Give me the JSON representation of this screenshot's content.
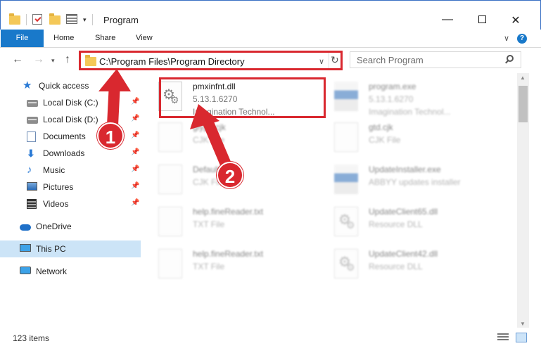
{
  "window": {
    "title": "Program",
    "min_glyph": "—",
    "close_glyph": "✕"
  },
  "ribbon": {
    "tabs": [
      "File",
      "Home",
      "Share",
      "View"
    ],
    "expand_glyph": "∨",
    "help_glyph": "?"
  },
  "nav": {
    "back_glyph": "←",
    "forward_glyph": "→",
    "recent_glyph": "▾",
    "up_glyph": "↑",
    "address": "C:\\Program Files\\Program Directory",
    "address_dropdown_glyph": "∨",
    "refresh_glyph": "↻",
    "search_placeholder": "Search Program"
  },
  "sidebar": {
    "items": [
      {
        "label": "Quick access",
        "icon": "star-icon"
      },
      {
        "label": "Local Disk (C:)",
        "icon": "drive-icon",
        "pinned": true
      },
      {
        "label": "Local Disk (D:)",
        "icon": "drive-icon",
        "pinned": true
      },
      {
        "label": "Documents",
        "icon": "documents-icon",
        "pinned": true
      },
      {
        "label": "Downloads",
        "icon": "downloads-icon",
        "pinned": true
      },
      {
        "label": "Music",
        "icon": "music-icon",
        "pinned": true
      },
      {
        "label": "Pictures",
        "icon": "pictures-icon",
        "pinned": true
      },
      {
        "label": "Videos",
        "icon": "videos-icon",
        "pinned": true
      },
      {
        "label": "OneDrive",
        "icon": "onedrive-icon"
      },
      {
        "label": "This PC",
        "icon": "this-pc-icon",
        "selected": true
      },
      {
        "label": "Network",
        "icon": "network-icon"
      }
    ],
    "pin_glyph": "📌"
  },
  "files": [
    {
      "name": "pmxinfnt.dll",
      "meta1": "5.13.1.6270",
      "meta2": "Imagination Technol...",
      "highlighted": true
    },
    {
      "name": "program.exe",
      "meta1": "5.13.1.6270",
      "meta2": "Imagination Technol..."
    },
    {
      "name": "glyph.cjk",
      "meta1": "CJK File",
      "meta2": ""
    },
    {
      "name": "gtd.cjk",
      "meta1": "CJK File",
      "meta2": ""
    },
    {
      "name": "Default.cjk",
      "meta1": "CJK File",
      "meta2": ""
    },
    {
      "name": "UpdateInstaller.exe",
      "meta1": "ABBYY updates installer",
      "meta2": ""
    },
    {
      "name": "help.fineReader.txt",
      "meta1": "TXT File",
      "meta2": ""
    },
    {
      "name": "UpdateClient65.dll",
      "meta1": "Resource DLL",
      "meta2": ""
    },
    {
      "name": "help.fineReader.txt",
      "meta1": "TXT File",
      "meta2": ""
    },
    {
      "name": "UpdateClient42.dll",
      "meta1": "Resource DLL",
      "meta2": ""
    }
  ],
  "status": {
    "item_count": "123 items"
  },
  "annotations": {
    "step1": "1",
    "step2": "2",
    "color": "#d9282f"
  }
}
